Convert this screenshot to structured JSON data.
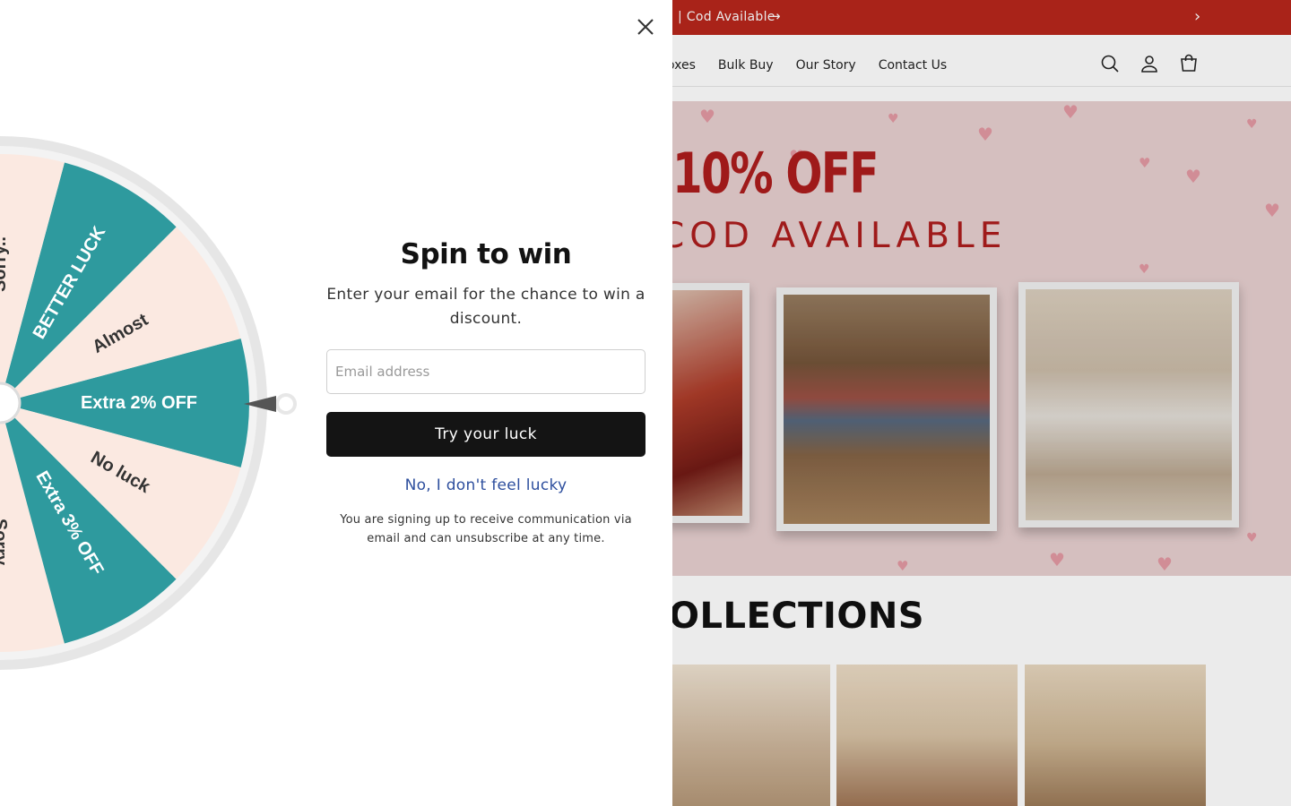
{
  "announcement": {
    "text": "| Cod Available",
    "arrow": "→",
    "next": "›"
  },
  "nav": {
    "items": [
      "oxes",
      "Bulk Buy",
      "Our Story",
      "Contact Us"
    ]
  },
  "header_icons": [
    "search-icon",
    "account-icon",
    "cart-icon"
  ],
  "hero": {
    "title": "10% OFF",
    "subtitle": "COD AVAILABLE"
  },
  "collections": {
    "heading": "OLLECTIONS"
  },
  "popup": {
    "title": "Spin to win",
    "subtitle": "Enter your email for the chance to win a discount.",
    "email_placeholder": "Email address",
    "email_value": "",
    "try_button": "Try your luck",
    "decline_link": "No, I don't feel lucky",
    "disclaimer": "You are signing up to receive communication via email and can unsubscribe at any time."
  },
  "wheel": {
    "segments": [
      "Extra 2% OFF",
      "Almost",
      "BETTER LUCK",
      "Sorry..",
      "Sorry",
      "Extra 3% OFF",
      "No luck"
    ]
  },
  "colors": {
    "teal": "#2e9a9e",
    "cream": "#fbe9e1",
    "brand_red": "#b8261c",
    "button_dark": "#141414",
    "link_blue": "#2e4f9e"
  }
}
